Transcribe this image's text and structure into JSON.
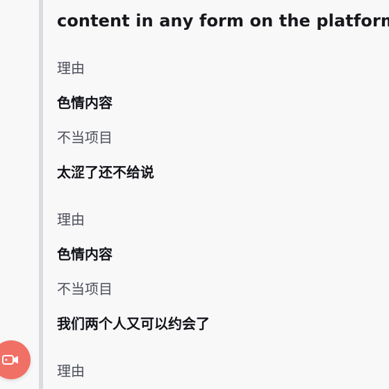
{
  "intro": {
    "text": "content in any form on the platform."
  },
  "entries": [
    {
      "label_reason": "理由",
      "reason": "色情内容",
      "label_item": "不当项目",
      "item": "太涩了还不给说"
    },
    {
      "label_reason": "理由",
      "reason": "色情内容",
      "label_item": "不当项目",
      "item": "我们两个人又可以约会了"
    },
    {
      "label_reason": "理由"
    }
  ],
  "fab": {
    "icon": "video-camera-icon",
    "color": "#f17066"
  }
}
